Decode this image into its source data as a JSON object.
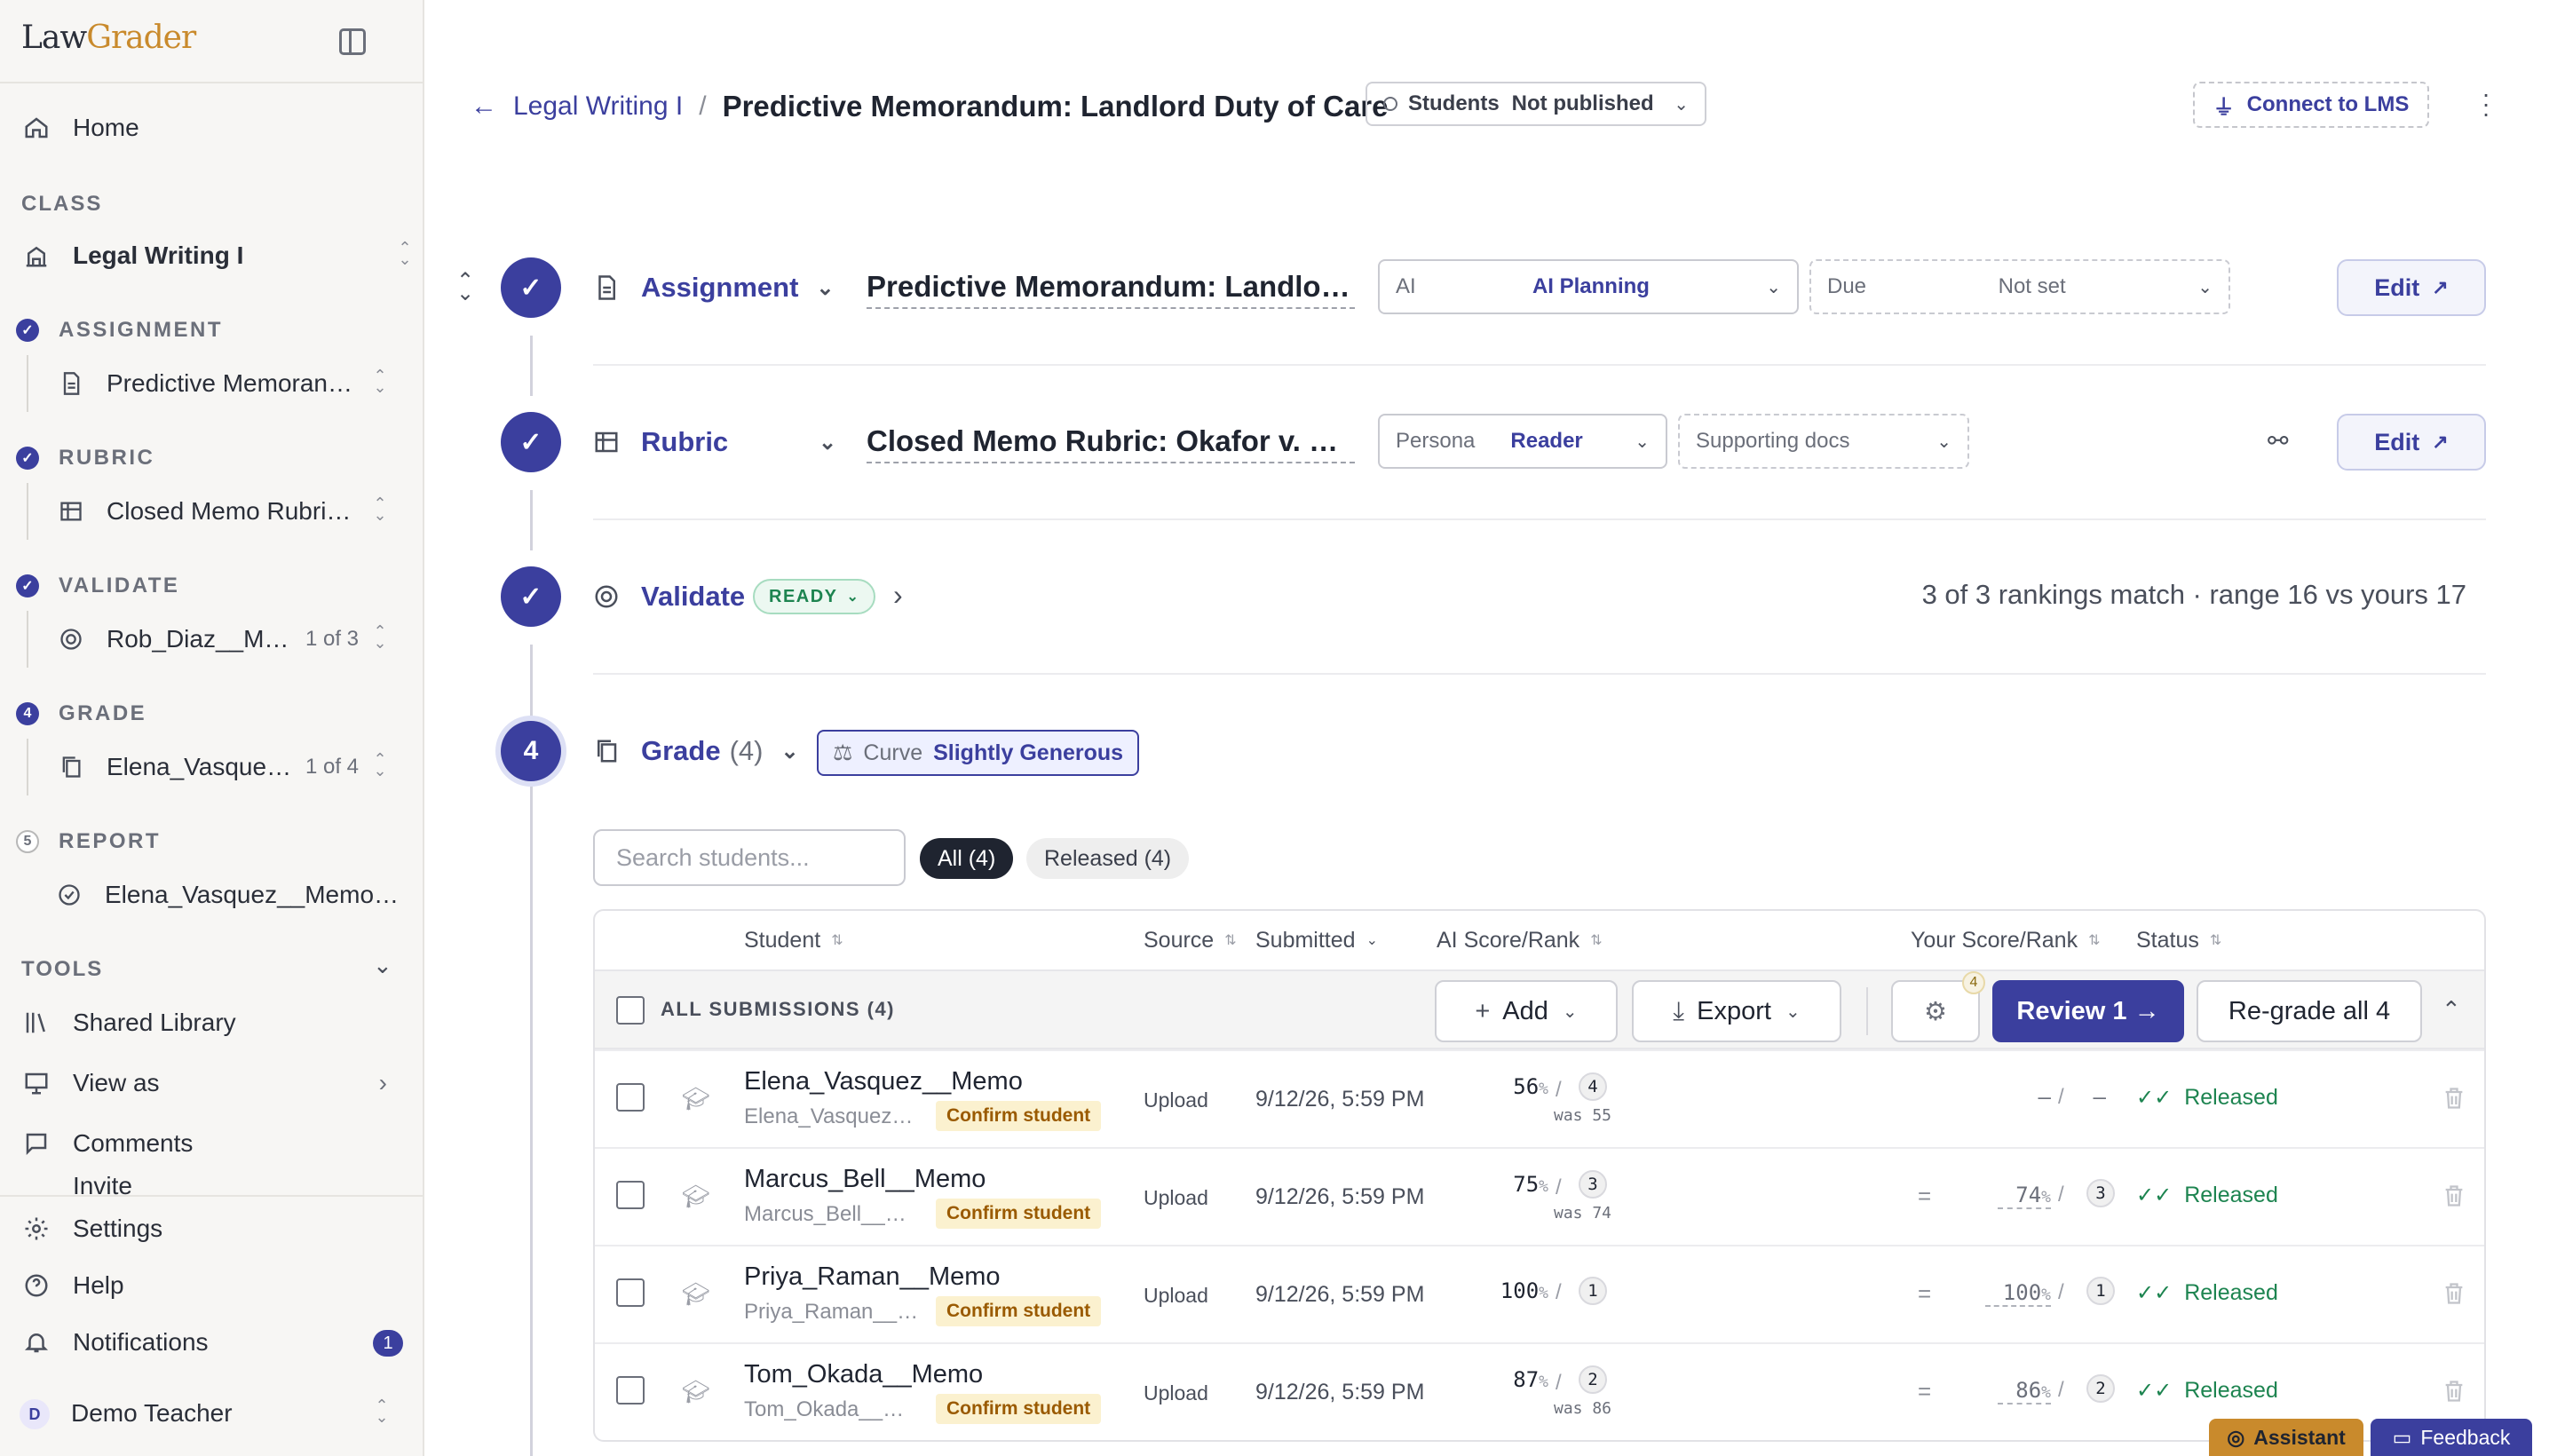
{
  "app": {
    "logo_part1": "Law",
    "logo_part2": "Grader"
  },
  "sidebar": {
    "home": "Home",
    "class_heading": "CLASS",
    "class_name": "Legal Writing I",
    "steps": [
      {
        "heading": "ASSIGNMENT",
        "item": "Predictive Memorandum: Landlord Duty of Care",
        "count": ""
      },
      {
        "heading": "RUBRIC",
        "item": "Closed Memo Rubric: Okafor v. Hartwell",
        "count": ""
      },
      {
        "heading": "VALIDATE",
        "item": "Rob_Diaz__Memo",
        "count": "1 of 3"
      },
      {
        "heading": "GRADE",
        "dot": "4",
        "item": "Elena_Vasquez__Memo",
        "count": "1 of 4"
      },
      {
        "heading": "REPORT",
        "dot": "5",
        "item": "Elena_Vasquez__Memo.docx",
        "count": ""
      }
    ],
    "tools_heading": "TOOLS",
    "tools": [
      "Shared Library",
      "View as",
      "Comments",
      "Invite"
    ],
    "bottom": [
      "Settings",
      "Help",
      "Notifications"
    ],
    "notifications_count": "1",
    "user_initial": "D",
    "user_name": "Demo Teacher"
  },
  "header": {
    "crumb_link": "Legal Writing I",
    "crumb_sep": "/",
    "title": "Predictive Memorandum: Landlord Duty of Care",
    "students_label": "Students",
    "students_value": "Not published",
    "lms_button": "Connect to LMS"
  },
  "workflow": {
    "assignment": {
      "label": "Assignment",
      "doc": "Predictive Memorandum: Landlord Duty of Care",
      "ai_key": "AI",
      "ai_value": "AI Planning",
      "due_key": "Due",
      "due_value": "Not set",
      "edit": "Edit"
    },
    "rubric": {
      "label": "Rubric",
      "doc": "Closed Memo Rubric: Okafor v. Hartwell",
      "persona_key": "Persona",
      "persona_value": "Reader",
      "supporting": "Supporting docs",
      "edit": "Edit"
    },
    "validate": {
      "label": "Validate",
      "badge": "READY",
      "summary": "3 of 3 rankings match · range 16 vs yours 17"
    },
    "grade": {
      "step": "4",
      "label": "Grade",
      "count": "(4)",
      "curve_key": "Curve",
      "curve_value": "Slightly Generous"
    }
  },
  "grade_table": {
    "search_placeholder": "Search students...",
    "filters": [
      "All (4)",
      "Released (4)"
    ],
    "columns": [
      "Student",
      "Source",
      "Submitted",
      "AI Score/Rank",
      "Your Score/Rank",
      "Status"
    ],
    "bulk_label": "ALL SUBMISSIONS (4)",
    "add": "Add",
    "export": "Export",
    "settings_badge": "4",
    "review": "Review 1 →",
    "regrade": "Re-grade all 4",
    "rows": [
      {
        "name": "Elena_Vasquez__Memo",
        "sub": "Elena_Vasquez__Memo",
        "confirm": "Confirm student",
        "source": "Upload",
        "submitted": "9/12/26, 5:59 PM",
        "ai_score": "56",
        "ai_rank": "4",
        "was": "was 55",
        "your_score": "—",
        "your_rank": "—",
        "eq": "",
        "status": "Released"
      },
      {
        "name": "Marcus_Bell__Memo",
        "sub": "Marcus_Bell__Memo",
        "confirm": "Confirm student",
        "source": "Upload",
        "submitted": "9/12/26, 5:59 PM",
        "ai_score": "75",
        "ai_rank": "3",
        "was": "was 74",
        "your_score": "74",
        "your_rank": "3",
        "eq": "=",
        "status": "Released"
      },
      {
        "name": "Priya_Raman__Memo",
        "sub": "Priya_Raman__Memo",
        "confirm": "Confirm student",
        "source": "Upload",
        "submitted": "9/12/26, 5:59 PM",
        "ai_score": "100",
        "ai_rank": "1",
        "was": "",
        "your_score": "100",
        "your_rank": "1",
        "eq": "=",
        "status": "Released"
      },
      {
        "name": "Tom_Okada__Memo",
        "sub": "Tom_Okada__Memo",
        "confirm": "Confirm student",
        "source": "Upload",
        "submitted": "9/12/26, 5:59 PM",
        "ai_score": "87",
        "ai_rank": "2",
        "was": "was 86",
        "your_score": "86",
        "your_rank": "2",
        "eq": "=",
        "status": "Released"
      }
    ]
  },
  "footer": {
    "assistant": "Assistant",
    "feedback": "Feedback"
  },
  "colors": {
    "accent": "#3b3f9e",
    "released": "#1d8450",
    "brand_gold": "#c98a2c"
  }
}
